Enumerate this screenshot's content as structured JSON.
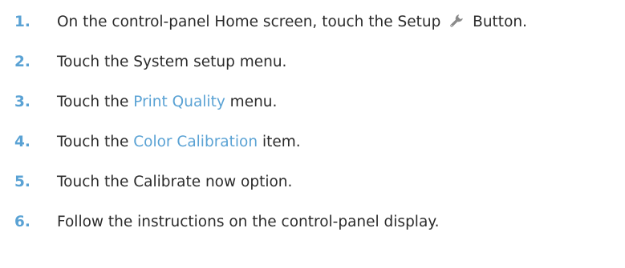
{
  "colors": {
    "accent": "#5aa2d4",
    "text": "#2b2b2b",
    "icon": "#8a8a8a"
  },
  "steps": [
    {
      "number": "1.",
      "before": "On the control-panel Home screen, touch the Setup",
      "icon": "wrench-icon",
      "after": "Button."
    },
    {
      "number": "2.",
      "text": "Touch the System setup menu."
    },
    {
      "number": "3.",
      "before": "Touch the",
      "link": "Print Quality",
      "after": "menu."
    },
    {
      "number": "4.",
      "before": "Touch the",
      "link": "Color Calibration",
      "after": "item."
    },
    {
      "number": "5.",
      "text": "Touch the Calibrate now option."
    },
    {
      "number": "6.",
      "text": "Follow the instructions on the control-panel display."
    }
  ]
}
